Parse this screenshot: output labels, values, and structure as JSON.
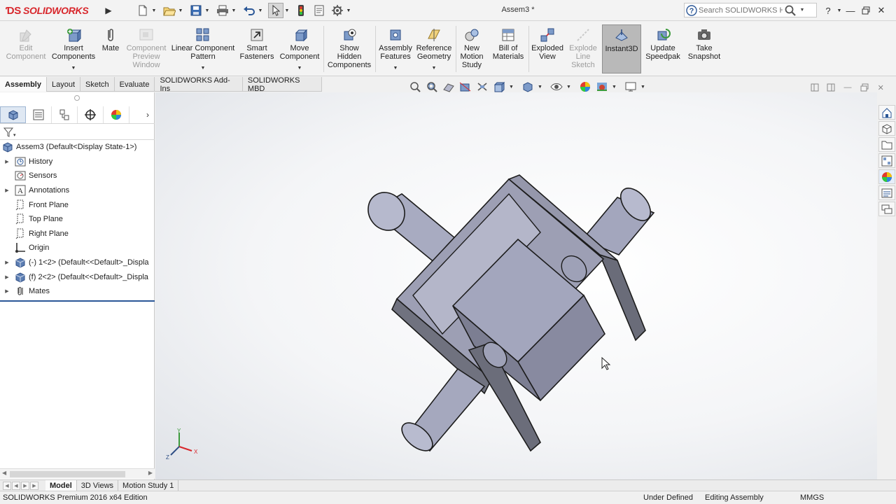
{
  "app": {
    "brand": "SOLIDWORKS",
    "document_title": "Assem3 *",
    "search_placeholder": "Search SOLIDWORKS Help",
    "help_glyph": "?"
  },
  "ribbon": {
    "buttons": [
      {
        "label": "Edit\nComponent",
        "enabled": false
      },
      {
        "label": "Insert\nComponents",
        "enabled": true
      },
      {
        "label": "Mate",
        "enabled": true
      },
      {
        "label": "Component\nPreview\nWindow",
        "enabled": false
      },
      {
        "label": "Linear Component\nPattern",
        "enabled": true
      },
      {
        "label": "Smart\nFasteners",
        "enabled": true
      },
      {
        "label": "Move\nComponent",
        "enabled": true
      },
      {
        "label": "Show\nHidden\nComponents",
        "enabled": true
      },
      {
        "label": "Assembly\nFeatures",
        "enabled": true
      },
      {
        "label": "Reference\nGeometry",
        "enabled": true
      },
      {
        "label": "New\nMotion\nStudy",
        "enabled": true
      },
      {
        "label": "Bill of\nMaterials",
        "enabled": true
      },
      {
        "label": "Exploded\nView",
        "enabled": true
      },
      {
        "label": "Explode\nLine\nSketch",
        "enabled": false
      },
      {
        "label": "Instant3D",
        "enabled": true,
        "active": true
      },
      {
        "label": "Update\nSpeedpak",
        "enabled": true
      },
      {
        "label": "Take\nSnapshot",
        "enabled": true
      }
    ]
  },
  "command_tabs": [
    "Assembly",
    "Layout",
    "Sketch",
    "Evaluate",
    "SOLIDWORKS Add-Ins",
    "SOLIDWORKS MBD"
  ],
  "active_command_tab": "Assembly",
  "feature_tree": {
    "root": "Assem3  (Default<Display State-1>)",
    "items": [
      {
        "label": "History",
        "expandable": true,
        "icon": "history-folder-icon"
      },
      {
        "label": "Sensors",
        "expandable": false,
        "icon": "sensors-icon"
      },
      {
        "label": "Annotations",
        "expandable": true,
        "icon": "annotations-icon"
      },
      {
        "label": "Front Plane",
        "expandable": false,
        "icon": "plane-icon"
      },
      {
        "label": "Top Plane",
        "expandable": false,
        "icon": "plane-icon"
      },
      {
        "label": "Right Plane",
        "expandable": false,
        "icon": "plane-icon"
      },
      {
        "label": "Origin",
        "expandable": false,
        "icon": "origin-icon"
      },
      {
        "label": "(-) 1<2> (Default<<Default>_Displa",
        "expandable": true,
        "icon": "part-icon"
      },
      {
        "label": "(f) 2<2> (Default<<Default>_Displa",
        "expandable": true,
        "icon": "part-icon"
      },
      {
        "label": "Mates",
        "expandable": true,
        "icon": "mates-icon"
      }
    ]
  },
  "bottom_tabs": [
    "Model",
    "3D Views",
    "Motion Study 1"
  ],
  "active_bottom_tab": "Model",
  "statusbar": {
    "edition": "SOLIDWORKS Premium 2016 x64 Edition",
    "state": "Under Defined",
    "mode": "Editing Assembly",
    "units": "MMGS"
  },
  "triad": {
    "x": "X",
    "y": "Y",
    "z": "Z"
  },
  "colors": {
    "brand_red": "#d8262b",
    "model_face": "#a3a6bd",
    "active_blue": "#2b5797"
  }
}
